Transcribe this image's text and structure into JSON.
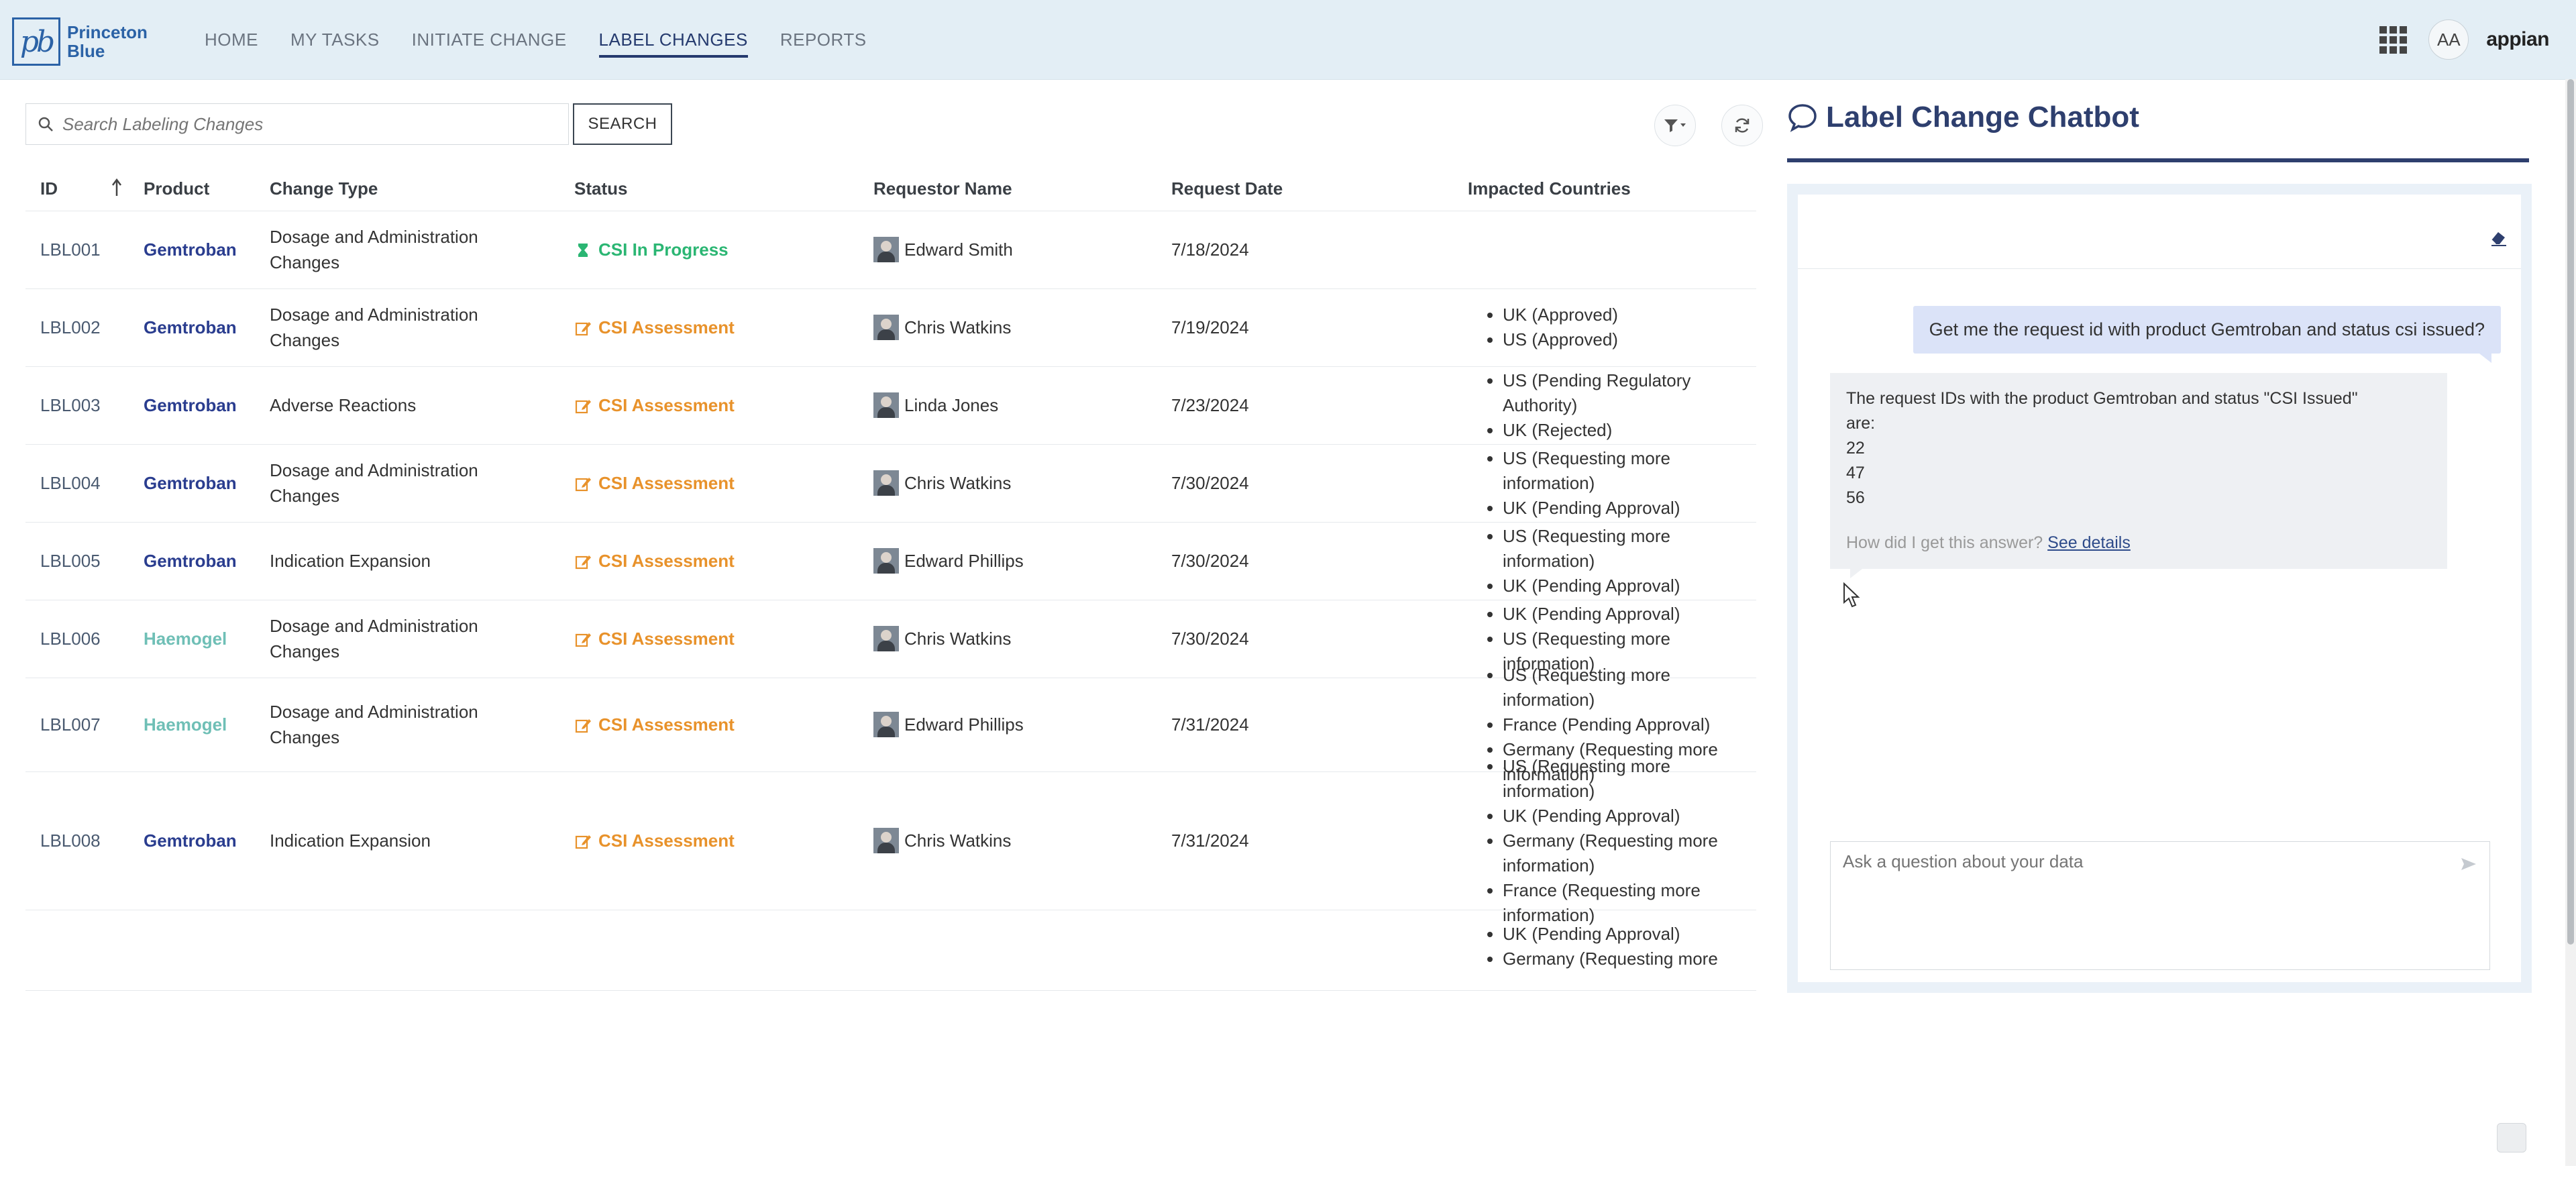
{
  "brand": {
    "logo_mark": "pb",
    "logo_line1": "Princeton",
    "logo_line2": "Blue",
    "appian": "appian",
    "user_initials": "AA"
  },
  "nav": [
    {
      "label": "HOME"
    },
    {
      "label": "MY TASKS"
    },
    {
      "label": "INITIATE CHANGE"
    },
    {
      "label": "LABEL CHANGES",
      "active": true
    },
    {
      "label": "REPORTS"
    }
  ],
  "search": {
    "placeholder": "Search Labeling Changes",
    "button_label": "SEARCH"
  },
  "table": {
    "headers": {
      "id": "ID",
      "product": "Product",
      "change_type": "Change Type",
      "status": "Status",
      "requestor": "Requestor Name",
      "date": "Request Date",
      "countries": "Impacted Countries"
    },
    "rows": [
      {
        "id": "LBL001",
        "product": "Gemtroban",
        "type": [
          "Dosage and Administration",
          "Changes"
        ],
        "status": "CSI In Progress",
        "status_kind": "progress",
        "requestor": "Edward Smith",
        "date": "7/18/2024",
        "countries": []
      },
      {
        "id": "LBL002",
        "product": "Gemtroban",
        "type": [
          "Dosage and Administration",
          "Changes"
        ],
        "status": "CSI Assessment",
        "status_kind": "assessment",
        "requestor": "Chris Watkins",
        "date": "7/19/2024",
        "countries": [
          "UK (Approved)",
          "US (Approved)"
        ]
      },
      {
        "id": "LBL003",
        "product": "Gemtroban",
        "type": [
          "Adverse Reactions"
        ],
        "status": "CSI Assessment",
        "status_kind": "assessment",
        "requestor": "Linda Jones",
        "date": "7/23/2024",
        "countries": [
          "US (Pending Regulatory Authority)",
          "UK (Rejected)"
        ]
      },
      {
        "id": "LBL004",
        "product": "Gemtroban",
        "type": [
          "Dosage and Administration",
          "Changes"
        ],
        "status": "CSI Assessment",
        "status_kind": "assessment",
        "requestor": "Chris Watkins",
        "date": "7/30/2024",
        "countries": [
          "US (Requesting more information)",
          "UK (Pending Approval)"
        ]
      },
      {
        "id": "LBL005",
        "product": "Gemtroban",
        "type": [
          "Indication Expansion"
        ],
        "status": "CSI Assessment",
        "status_kind": "assessment",
        "requestor": "Edward Phillips",
        "date": "7/30/2024",
        "countries": [
          "US (Requesting more information)",
          "UK (Pending Approval)"
        ]
      },
      {
        "id": "LBL006",
        "product": "Haemogel",
        "type": [
          "Dosage and Administration",
          "Changes"
        ],
        "status": "CSI Assessment",
        "status_kind": "assessment",
        "requestor": "Chris Watkins",
        "date": "7/30/2024",
        "countries": [
          "UK (Pending Approval)",
          "US (Requesting more information)"
        ]
      },
      {
        "id": "LBL007",
        "product": "Haemogel",
        "type": [
          "Dosage and Administration",
          "Changes"
        ],
        "status": "CSI Assessment",
        "status_kind": "assessment",
        "requestor": "Edward Phillips",
        "date": "7/31/2024",
        "countries": [
          "US (Requesting more information)",
          "France (Pending Approval)",
          "Germany (Requesting more information)"
        ]
      },
      {
        "id": "LBL008",
        "product": "Gemtroban",
        "type": [
          "Indication Expansion"
        ],
        "status": "CSI Assessment",
        "status_kind": "assessment",
        "requestor": "Chris Watkins",
        "date": "7/31/2024",
        "countries": [
          "US (Requesting more information)",
          "UK (Pending Approval)",
          "Germany (Requesting more information)",
          "France (Requesting more information)"
        ]
      },
      {
        "id": "",
        "product": "",
        "type": [],
        "status": "",
        "status_kind": "none",
        "requestor": "",
        "date": "",
        "countries": [
          "UK (Pending Approval)",
          "Germany (Requesting more"
        ]
      }
    ]
  },
  "chat": {
    "title": "Label Change Chatbot",
    "user_message": "Get me the request id with product Gemtroban and  status csi issued?",
    "bot_lines": [
      "The request IDs with the product Gemtroban and status \"CSI Issued\"",
      "are:",
      "22",
      "47",
      "56"
    ],
    "how_text": "How did I get this answer?",
    "see_details": "See details",
    "input_placeholder": "Ask a question about your data"
  },
  "colors": {
    "header_bg": "#e3eef5",
    "nav_active": "#253a6e",
    "product_gemtroban": "#2a3d8f",
    "product_haemogel": "#6fbfb6",
    "status_progress": "#2bb673",
    "status_assessment": "#e8922b",
    "chat_title": "#2e3f6e"
  }
}
